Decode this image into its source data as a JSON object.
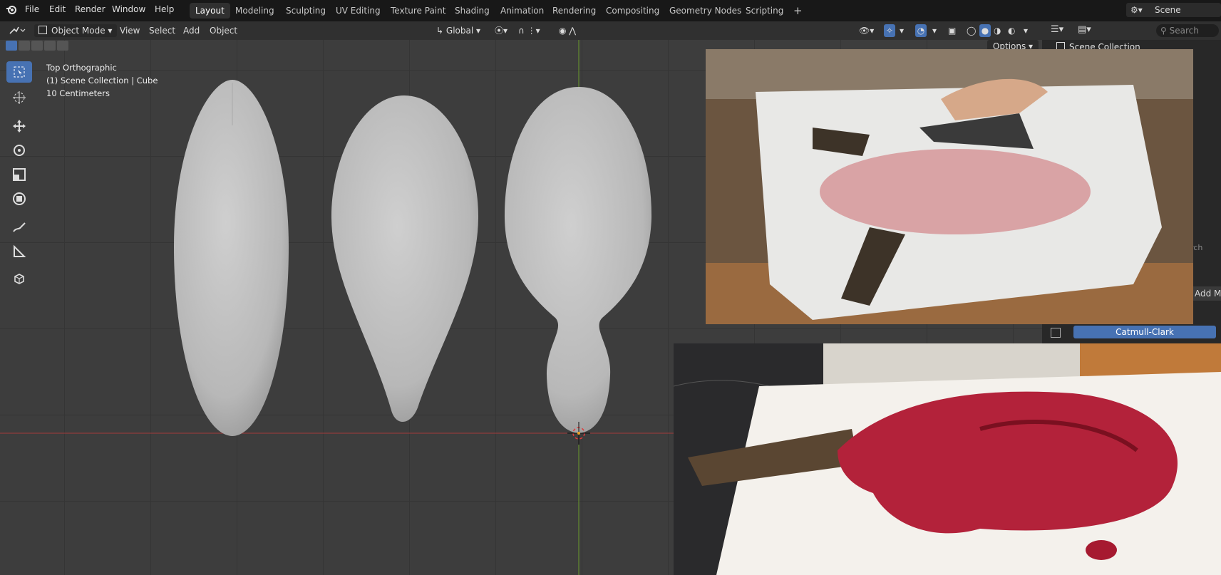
{
  "topbar": {
    "menus": [
      "File",
      "Edit",
      "Render",
      "Window",
      "Help"
    ],
    "workspace_tabs": [
      "Layout",
      "Modeling",
      "Sculpting",
      "UV Editing",
      "Texture Paint",
      "Shading",
      "Animation",
      "Rendering",
      "Compositing",
      "Geometry Nodes",
      "Scripting"
    ],
    "active_tab": "Layout",
    "add_tab": "+",
    "scene": "Scene"
  },
  "header": {
    "mode": "Object Mode",
    "menus": [
      "View",
      "Select",
      "Add",
      "Object"
    ],
    "orientation": "Global",
    "options": "Options"
  },
  "viewport": {
    "view_name": "Top Orthographic",
    "collection": "(1) Scene Collection | Cube",
    "scale": "10 Centimeters"
  },
  "outliner": {
    "root": "Scene Collection",
    "search_placeholder": "Search",
    "search_placeholder_2": "rch"
  },
  "properties": {
    "add_modifier": "Add M",
    "subdivision_type": "Catmull-Clark"
  },
  "colors": {
    "accent": "#4772b3",
    "x_axis": "#b43c3c",
    "y_axis": "#6a9a2a"
  }
}
